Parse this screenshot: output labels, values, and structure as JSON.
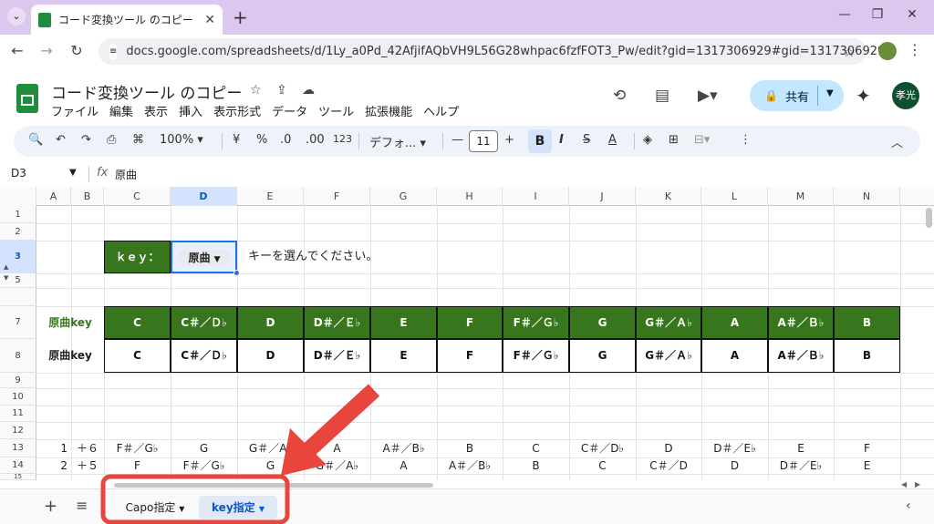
{
  "browser": {
    "tab_title": "コード変換ツール のコピー - Google",
    "url": "docs.google.com/spreadsheets/d/1Ly_a0Pd_42AfjifAQbVH9L56G28whpac6fzfFOT3_Pw/edit?gid=1317306929#gid=1317306929"
  },
  "app": {
    "doc_title": "コード変換ツール のコピー",
    "menus": [
      "ファイル",
      "編集",
      "表示",
      "挿入",
      "表示形式",
      "データ",
      "ツール",
      "拡張機能",
      "ヘルプ"
    ],
    "share_label": "共有",
    "avatar_text": "孝光"
  },
  "toolbar": {
    "zoom": "100%",
    "currency": "¥",
    "percent": "%",
    "dec_decrease": ".0",
    "dec_increase": ".00",
    "number_format": "123",
    "font_name": "デフォ...",
    "font_size": "11",
    "bold": "B",
    "italic": "I",
    "strike": "S",
    "text_color": "A"
  },
  "formula_bar": {
    "cell_ref": "D3",
    "fx": "fx",
    "value": "原曲"
  },
  "grid": {
    "columns": [
      "A",
      "B",
      "C",
      "D",
      "E",
      "F",
      "G",
      "H",
      "I",
      "J",
      "K",
      "L",
      "M",
      "N"
    ],
    "rows": [
      "1",
      "2",
      "3",
      "5",
      "7",
      "8",
      "9",
      "10",
      "11",
      "12",
      "13",
      "14",
      "15"
    ],
    "key_label": "ｋｅｙ：",
    "key_select": "原曲",
    "instruction": "キーを選んでください。",
    "row7_label": "原曲key",
    "row8_label": "原曲key",
    "keys": [
      "C",
      "C＃／Ｄ♭",
      "D",
      "D＃／Ｅ♭",
      "E",
      "F",
      "F＃／Ｇ♭",
      "G",
      "G＃／Ａ♭",
      "A",
      "A＃／Ｂ♭",
      "B"
    ],
    "row13": {
      "a": "1",
      "b": "＋６",
      "values": [
        "F＃／G♭",
        "G",
        "G＃／A♭",
        "A",
        "A＃／B♭",
        "B",
        "C",
        "C＃／D♭",
        "D",
        "D＃／E♭",
        "E",
        "F"
      ]
    },
    "row14": {
      "a": "2",
      "b": "＋５",
      "values": [
        "F",
        "F＃／G♭",
        "G",
        "G＃／A♭",
        "A",
        "A＃／B♭",
        "B",
        "C",
        "C＃／D",
        "D",
        "D＃／E♭",
        "E"
      ]
    }
  },
  "sheets": {
    "tabs": [
      "Capo指定",
      "key指定"
    ],
    "active": "key指定"
  },
  "annotation": {
    "arrow_color": "#e8453c"
  }
}
